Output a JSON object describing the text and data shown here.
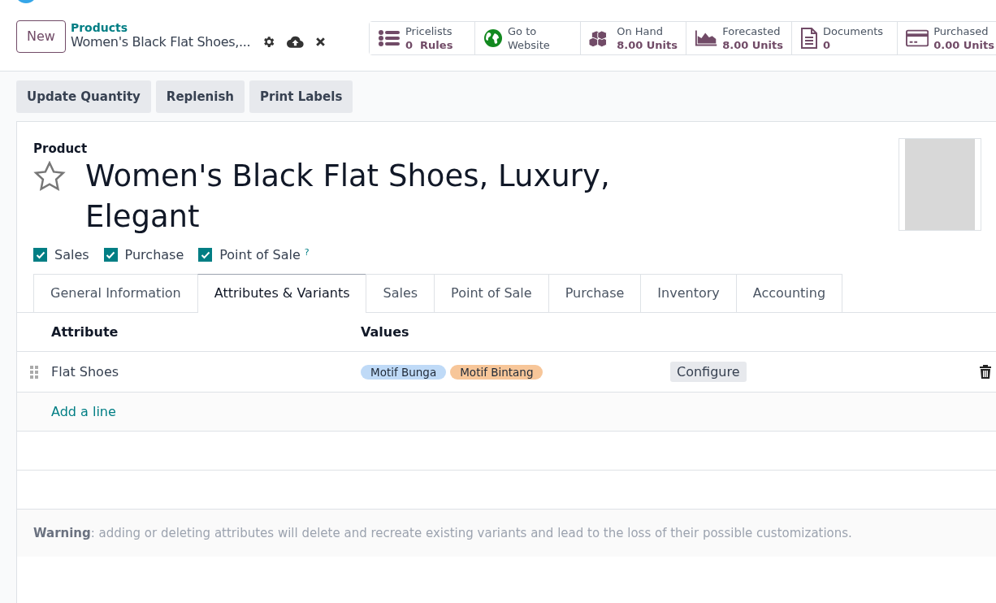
{
  "control_panel": {
    "new_button": "New",
    "breadcrumb": "Products",
    "record_name": "Women's Black Flat Shoes,..."
  },
  "stat_buttons": [
    {
      "label": "Pricelists",
      "value": "0  Rules"
    },
    {
      "label": "Go to",
      "value": "Website"
    },
    {
      "label": "On Hand",
      "value": "8.00 Units"
    },
    {
      "label": "Forecasted",
      "value": "8.00 Units"
    },
    {
      "label": "Documents",
      "value": "0"
    },
    {
      "label": "Purchased",
      "value": "0.00 Units"
    }
  ],
  "action_buttons": [
    "Update Quantity",
    "Replenish",
    "Print Labels"
  ],
  "form": {
    "field_label": "Product",
    "favorite": false,
    "name": "Women's Black Flat Shoes, Luxury, Elegant",
    "flags": [
      {
        "label": "Sales",
        "checked": true
      },
      {
        "label": "Purchase",
        "checked": true
      },
      {
        "label": "Point of Sale",
        "checked": true,
        "help": "?"
      }
    ]
  },
  "tabs": [
    {
      "label": "General Information",
      "selected": false
    },
    {
      "label": "Attributes & Variants",
      "selected": true
    },
    {
      "label": "Sales",
      "selected": false
    },
    {
      "label": "Point of Sale",
      "selected": false
    },
    {
      "label": "Purchase",
      "selected": false
    },
    {
      "label": "Inventory",
      "selected": false
    },
    {
      "label": "Accounting",
      "selected": false
    }
  ],
  "table": {
    "columns": [
      "Attribute",
      "Values"
    ],
    "rows": [
      {
        "attribute": "Flat Shoes",
        "values": [
          {
            "label": "Motif Bunga",
            "color": "#bfdaf7"
          },
          {
            "label": "Motif Bintang",
            "color": "#f7c699"
          }
        ],
        "action": "Configure"
      }
    ],
    "add_line": "Add a line"
  },
  "warning": "**Warning**: adding or deleting attributes will delete and recreate existing variants and lead to the loss of their possible customizations."
}
